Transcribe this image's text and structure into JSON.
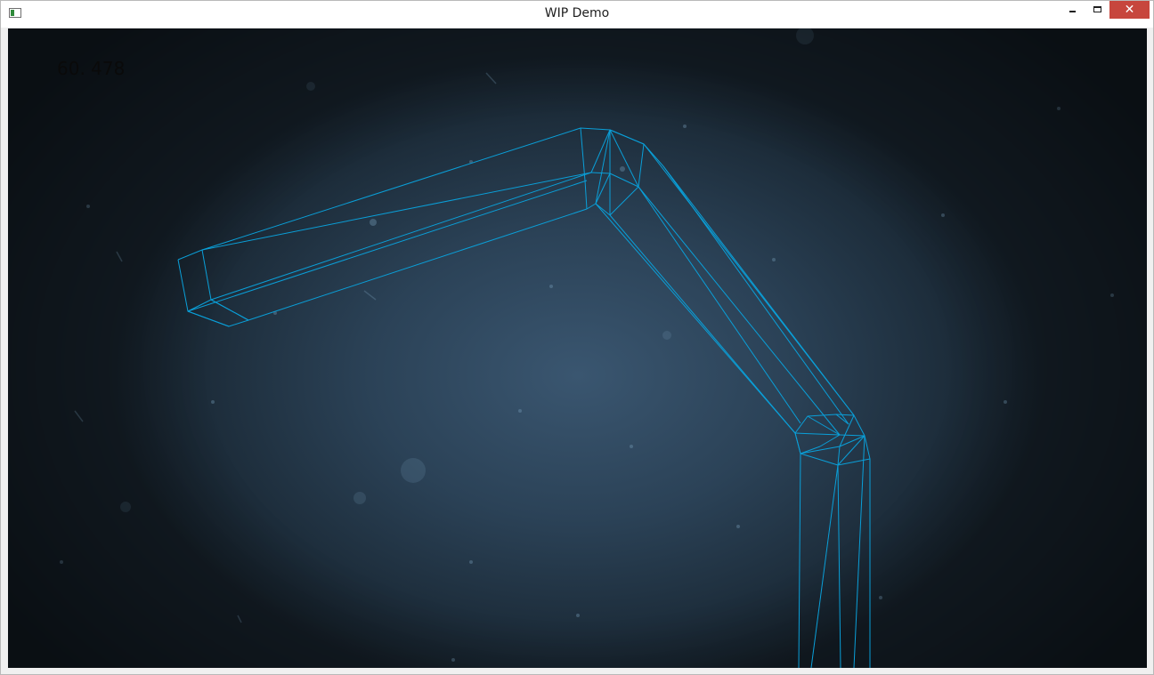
{
  "window": {
    "title": "WIP Demo",
    "close_glyph": "✕"
  },
  "viewport": {
    "fps_readout": "60. 478",
    "wire_color": "#0a9fd8",
    "background_color": "#2b4257"
  }
}
